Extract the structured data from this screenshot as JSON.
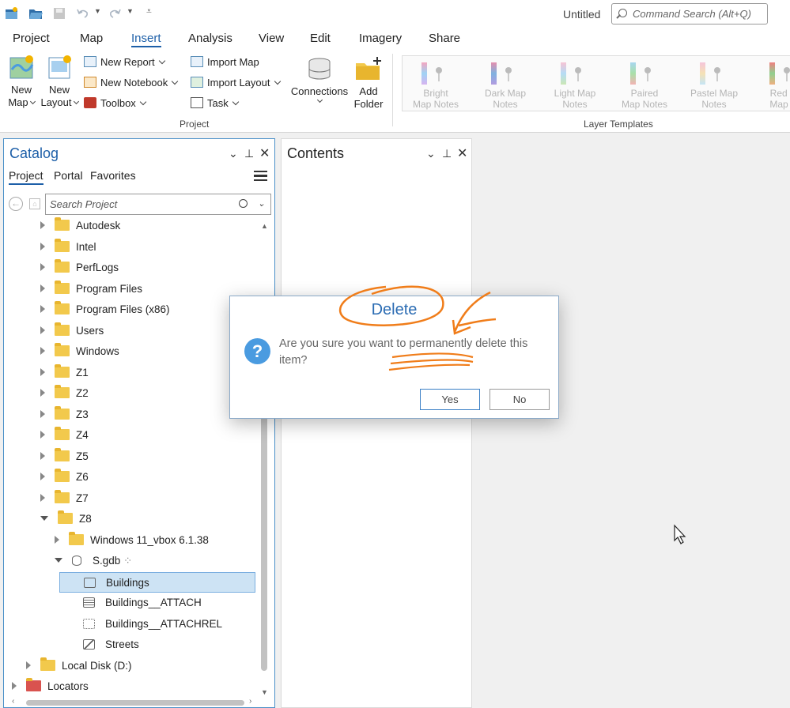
{
  "titlebar": {
    "doc_title": "Untitled",
    "search_placeholder": "Command Search (Alt+Q)"
  },
  "tabs": [
    "Project",
    "Map",
    "Insert",
    "Analysis",
    "View",
    "Edit",
    "Imagery",
    "Share"
  ],
  "active_tab": "Insert",
  "ribbon": {
    "new_map": [
      "New",
      "Map"
    ],
    "new_layout": [
      "New",
      "Layout"
    ],
    "new_report": "New Report",
    "new_notebook": "New Notebook",
    "toolbox": "Toolbox",
    "import_map": "Import Map",
    "import_layout": "Import Layout",
    "task": "Task",
    "connections": "Connections",
    "add_folder": [
      "Add",
      "Folder"
    ],
    "project_group": "Project",
    "layer_templates_group": "Layer Templates",
    "templates": [
      {
        "l1": "Bright",
        "l2": "Map Notes",
        "colors": [
          "#f4a6c0",
          "#9fd3f5",
          "#d6b3f0"
        ]
      },
      {
        "l1": "Dark Map",
        "l2": "Notes",
        "colors": [
          "#e58fae",
          "#7fb2e0",
          "#b29be0"
        ]
      },
      {
        "l1": "Light Map",
        "l2": "Notes",
        "colors": [
          "#f7c3d4",
          "#b5dcf6",
          "#cbe7b5"
        ]
      },
      {
        "l1": "Paired",
        "l2": "Map Notes",
        "colors": [
          "#a8d6f0",
          "#a8e0a8",
          "#f3b3b3"
        ]
      },
      {
        "l1": "Pastel Map",
        "l2": "Notes",
        "colors": [
          "#f5c5da",
          "#f5e1b5",
          "#c5e5f5"
        ]
      },
      {
        "l1": "Red G",
        "l2": "Map N",
        "colors": [
          "#f08080",
          "#90d090",
          "#f0b080"
        ]
      }
    ]
  },
  "catalog": {
    "title": "Catalog",
    "subtabs": [
      "Project",
      "Portal",
      "Favorites"
    ],
    "search_placeholder": "Search Project",
    "tree": [
      {
        "label": "Autodesk",
        "indent": 0,
        "kind": "folder",
        "state": "closed"
      },
      {
        "label": "Intel",
        "indent": 0,
        "kind": "folder",
        "state": "closed"
      },
      {
        "label": "PerfLogs",
        "indent": 0,
        "kind": "folder",
        "state": "closed"
      },
      {
        "label": "Program Files",
        "indent": 0,
        "kind": "folder",
        "state": "closed"
      },
      {
        "label": "Program Files (x86)",
        "indent": 0,
        "kind": "folder",
        "state": "closed"
      },
      {
        "label": "Users",
        "indent": 0,
        "kind": "folder",
        "state": "closed"
      },
      {
        "label": "Windows",
        "indent": 0,
        "kind": "folder",
        "state": "closed"
      },
      {
        "label": "Z1",
        "indent": 0,
        "kind": "folder",
        "state": "closed"
      },
      {
        "label": "Z2",
        "indent": 0,
        "kind": "folder",
        "state": "closed"
      },
      {
        "label": "Z3",
        "indent": 0,
        "kind": "folder",
        "state": "closed"
      },
      {
        "label": "Z4",
        "indent": 0,
        "kind": "folder",
        "state": "closed"
      },
      {
        "label": "Z5",
        "indent": 0,
        "kind": "folder",
        "state": "closed"
      },
      {
        "label": "Z6",
        "indent": 0,
        "kind": "folder",
        "state": "closed"
      },
      {
        "label": "Z7",
        "indent": 0,
        "kind": "folder",
        "state": "closed"
      },
      {
        "label": "Z8",
        "indent": 0,
        "kind": "folder",
        "state": "open"
      },
      {
        "label": "Windows 11_vbox 6.1.38",
        "indent": 1,
        "kind": "folder",
        "state": "closed"
      },
      {
        "label": "S.gdb",
        "indent": 1,
        "kind": "gdb",
        "state": "open"
      },
      {
        "label": "Buildings",
        "indent": 2,
        "kind": "fc",
        "state": "none",
        "selected": true
      },
      {
        "label": "Buildings__ATTACH",
        "indent": 2,
        "kind": "table",
        "state": "none"
      },
      {
        "label": "Buildings__ATTACHREL",
        "indent": 2,
        "kind": "rel",
        "state": "none"
      },
      {
        "label": "Streets",
        "indent": 2,
        "kind": "line",
        "state": "none"
      },
      {
        "label": "Local Disk (D:)",
        "indent": -1,
        "kind": "folder",
        "state": "closed"
      },
      {
        "label": "Locators",
        "indent": -2,
        "kind": "locator",
        "state": "closed"
      }
    ]
  },
  "contents": {
    "title": "Contents"
  },
  "dialog": {
    "title": "Delete",
    "message": "Are you sure you want to permanently delete this item?",
    "yes_label": "Yes",
    "no_label": "No"
  },
  "colors": {
    "accent": "#1d5fa8",
    "annotation": "#f07d1a",
    "selection": "#cde3f4"
  }
}
